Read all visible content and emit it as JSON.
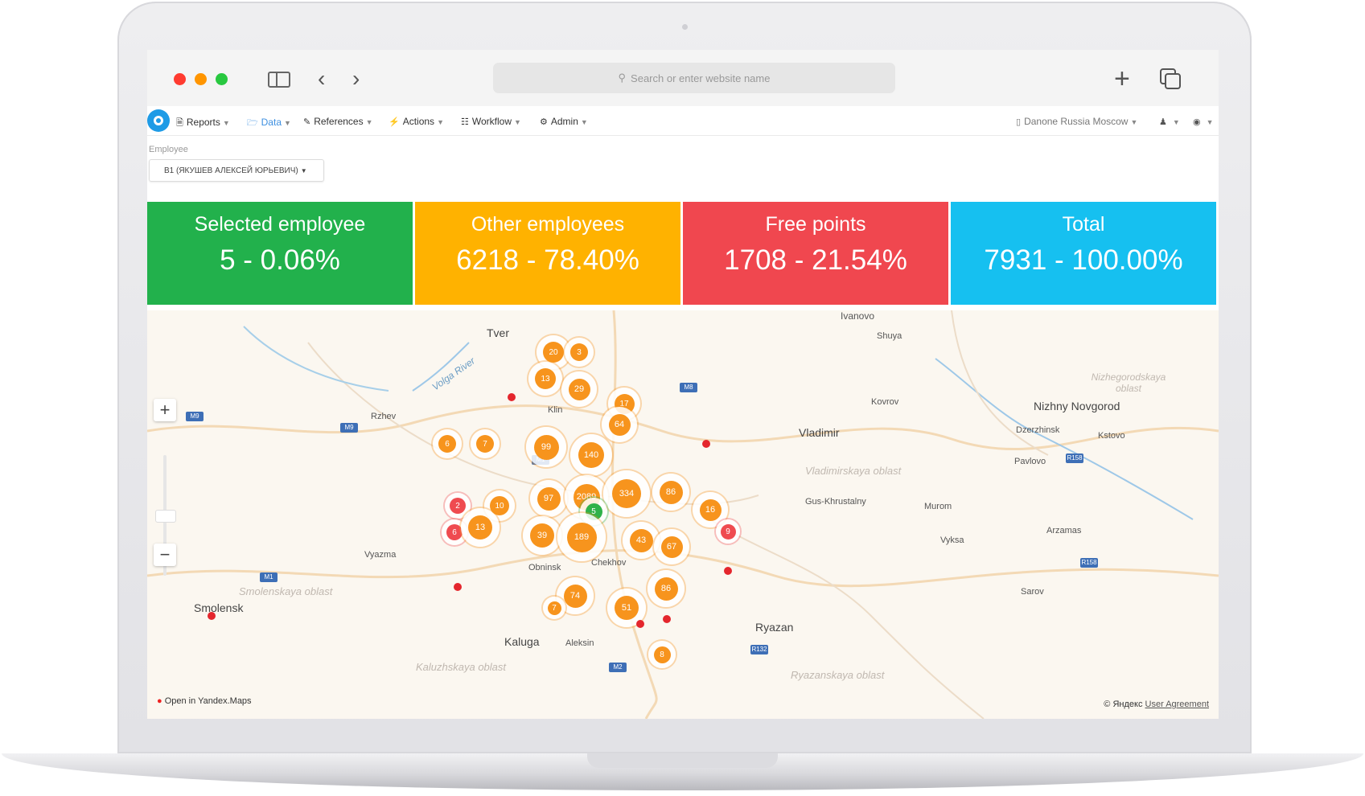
{
  "browser": {
    "address_placeholder": "Search or enter website name"
  },
  "nav": {
    "items": [
      {
        "label": "Reports",
        "icon": "document-icon"
      },
      {
        "label": "Data",
        "icon": "folder-icon"
      },
      {
        "label": "References",
        "icon": "pencil-icon"
      },
      {
        "label": "Actions",
        "icon": "bolt-icon"
      },
      {
        "label": "Workflow",
        "icon": "clipboard-icon"
      },
      {
        "label": "Admin",
        "icon": "gear-icon"
      }
    ],
    "company": "Danone Russia Moscow"
  },
  "filter": {
    "label": "Employee",
    "value": "B1 (ЯКУШЕВ АЛЕКСЕЙ ЮРЬЕВИЧ)"
  },
  "cards": [
    {
      "title": "Selected employee",
      "value": "5 - 0.06%",
      "color": "#22b14c"
    },
    {
      "title": "Other employees",
      "value": "6218 - 78.40%",
      "color": "#ffb200"
    },
    {
      "title": "Free points",
      "value": "1708 - 21.54%",
      "color": "#f0474f"
    },
    {
      "title": "Total",
      "value": "7931 - 100.00%",
      "color": "#16c0f0"
    }
  ],
  "map": {
    "labels": {
      "tver": "Tver",
      "volga": "Volga River",
      "ivanovo": "Ivanovo",
      "shuya": "Shuya",
      "nizh_obl": "Nizhegorodskaya oblast",
      "klin": "Klin",
      "rzhev": "Rzhev",
      "kovrov": "Kovrov",
      "nizhny": "Nizhny Novgorod",
      "dzerzhinsk": "Dzerzhinsk",
      "kstovo": "Kstovo",
      "vladimir": "Vladimir",
      "pavlovo": "Pavlovo",
      "vlad_obl": "Vladimirskaya oblast",
      "gus": "Gus-Khrustalny",
      "murom": "Murom",
      "arzamas": "Arzamas",
      "vyksa": "Vyksa",
      "vyazma": "Vyazma",
      "obninsk": "Obninsk",
      "chekhov": "Chekhov",
      "smolensk_obl": "Smolenskaya oblast",
      "smolensk": "Smolensk",
      "sarov": "Sarov",
      "ryazan": "Ryazan",
      "kaluga": "Kaluga",
      "aleksin": "Aleksin",
      "kaluzh_obl": "Kaluzhskaya oblast",
      "ryaz_obl": "Ryazanskaya oblast"
    },
    "open_in": "Open in Yandex.Maps",
    "copyright": "© Яндекс",
    "agreement": "User Agreement"
  },
  "clusters": [
    {
      "label": "20",
      "kind": "other"
    },
    {
      "label": "3",
      "kind": "other"
    },
    {
      "label": "13",
      "kind": "other"
    },
    {
      "label": "29",
      "kind": "other"
    },
    {
      "label": "17",
      "kind": "other"
    },
    {
      "label": "64",
      "kind": "other"
    },
    {
      "label": "6",
      "kind": "other"
    },
    {
      "label": "7",
      "kind": "other"
    },
    {
      "label": "99",
      "kind": "other"
    },
    {
      "label": "140",
      "kind": "other"
    },
    {
      "label": "2",
      "kind": "free"
    },
    {
      "label": "10",
      "kind": "other"
    },
    {
      "label": "97",
      "kind": "other"
    },
    {
      "label": "2089",
      "kind": "other"
    },
    {
      "label": "334",
      "kind": "other"
    },
    {
      "label": "86",
      "kind": "other"
    },
    {
      "label": "16",
      "kind": "other"
    },
    {
      "label": "5",
      "kind": "selected"
    },
    {
      "label": "6",
      "kind": "free"
    },
    {
      "label": "13",
      "kind": "other"
    },
    {
      "label": "39",
      "kind": "other"
    },
    {
      "label": "189",
      "kind": "other"
    },
    {
      "label": "43",
      "kind": "other"
    },
    {
      "label": "67",
      "kind": "other"
    },
    {
      "label": "9",
      "kind": "free"
    },
    {
      "label": "74",
      "kind": "other"
    },
    {
      "label": "7",
      "kind": "other"
    },
    {
      "label": "51",
      "kind": "other"
    },
    {
      "label": "86",
      "kind": "other"
    },
    {
      "label": "8",
      "kind": "other"
    }
  ],
  "colors": {
    "other": "#f7941d",
    "free": "#ef4b50",
    "selected": "#2fb24a"
  }
}
